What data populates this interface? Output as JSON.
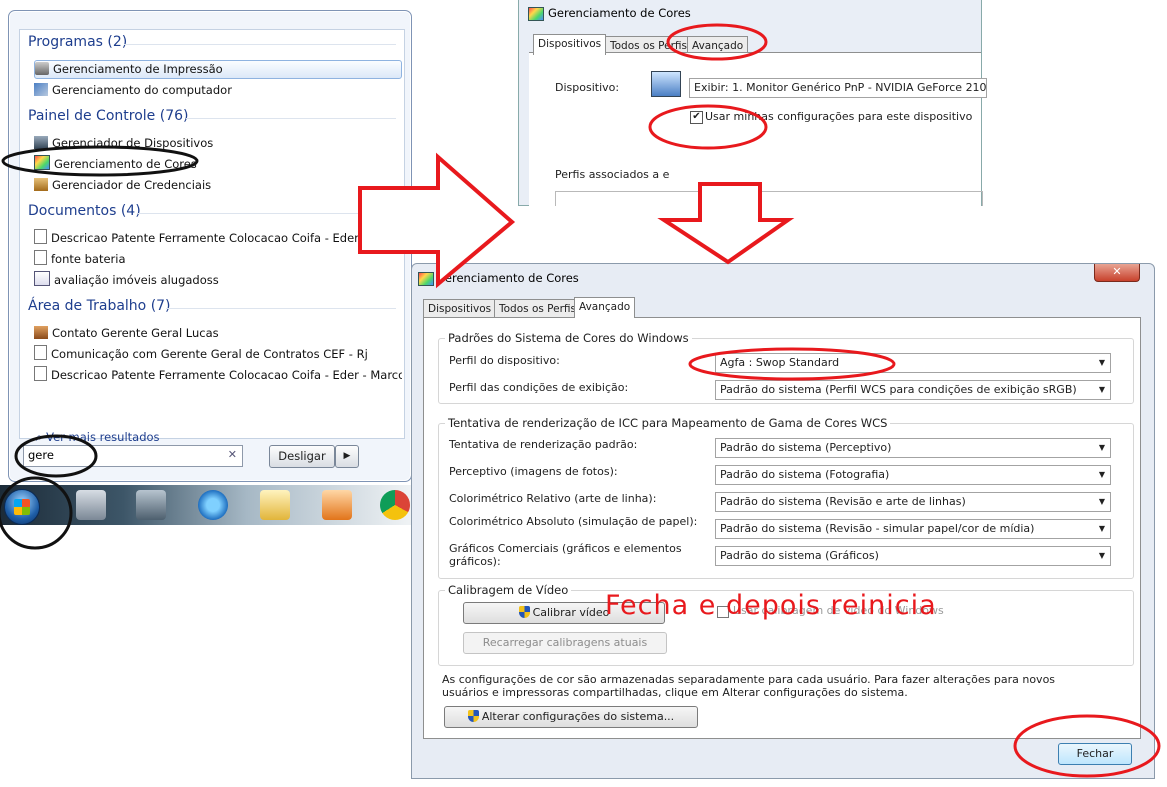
{
  "start_menu": {
    "categories": [
      {
        "title": "Programas (2)",
        "items": [
          "Gerenciamento de Impressão",
          "Gerenciamento do computador"
        ]
      },
      {
        "title": "Painel de Controle (76)",
        "items": [
          "Gerenciador de Dispositivos",
          "Gerenciamento de Cores",
          "Gerenciador de Credenciais"
        ]
      },
      {
        "title": "Documentos (4)",
        "items": [
          "Descricao Patente Ferramente Colocacao Coifa - Eder - Marc...",
          "fonte bateria",
          "avaliação imóveis alugadoss"
        ]
      },
      {
        "title": "Área de Trabalho (7)",
        "items": [
          "Contato Gerente Geral Lucas",
          "Comunicação com Gerente Geral de Contratos CEF - Rj",
          "Descricao Patente Ferramente Colocacao Coifa - Eder - Marco ..."
        ]
      }
    ],
    "more_results": "Ver mais resultados",
    "search_value": "gere",
    "shutdown_label": "Desligar"
  },
  "window_top": {
    "title": "Gerenciamento de Cores",
    "tabs": [
      "Dispositivos",
      "Todos os Perfis",
      "Avançado"
    ],
    "device_label": "Dispositivo:",
    "device_value": "Exibir: 1. Monitor Genérico PnP - NVIDIA GeForce 210",
    "use_settings_label": "Usar minhas configurações para este dispositivo",
    "profiles_label": "Perfis associados a e"
  },
  "window_main": {
    "title": "Gerenciamento de Cores",
    "tabs": [
      "Dispositivos",
      "Todos os Perfis",
      "Avançado"
    ],
    "group_wcs": {
      "title": "Padrões do Sistema de Cores do Windows",
      "rows": [
        {
          "label": "Perfil do dispositivo:",
          "value": "Agfa : Swop Standard"
        },
        {
          "label": "Perfil das condições de exibição:",
          "value": "Padrão do sistema (Perfil WCS para condições de exibição sRGB)"
        }
      ]
    },
    "group_icc": {
      "title": "Tentativa de renderização de ICC para Mapeamento de Gama de Cores WCS",
      "rows": [
        {
          "label": "Tentativa de renderização padrão:",
          "value": "Padrão do sistema (Perceptivo)"
        },
        {
          "label": "Perceptivo (imagens de fotos):",
          "value": "Padrão do sistema (Fotografia)"
        },
        {
          "label": "Colorimétrico Relativo (arte de linha):",
          "value": "Padrão do sistema (Revisão e arte de linhas)"
        },
        {
          "label": "Colorimétrico Absoluto (simulação de papel):",
          "value": "Padrão do sistema (Revisão - simular papel/cor de mídia)"
        },
        {
          "label": "Gráficos Comerciais (gráficos e elementos gráficos):",
          "value": "Padrão do sistema (Gráficos)"
        }
      ]
    },
    "group_calib": {
      "title": "Calibragem de Vídeo",
      "calibrate_label": "Calibrar vídeo",
      "use_windows_label": "Usar calibragem de vídeo do Windows",
      "reload_label": "Recarregar calibragens atuais"
    },
    "info_text": "As configurações de cor são armazenadas separadamente para cada usuário. Para fazer alterações para novos usuários e impressoras compartilhadas, clique em Alterar configurações do sistema.",
    "change_system_label": "Alterar configurações do sistema...",
    "close_label": "Fechar"
  },
  "annotation": "Fecha e depois reinicia",
  "colors": {
    "annotation": "#e8191d",
    "category": "#1e3e8e"
  }
}
